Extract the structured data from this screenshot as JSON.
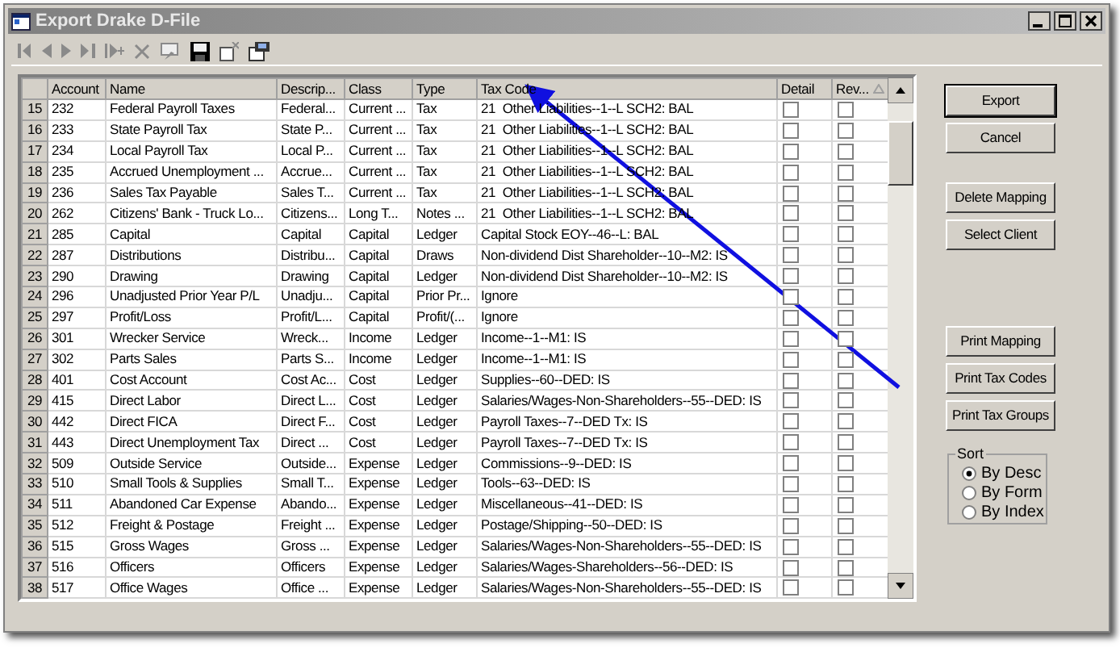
{
  "window": {
    "title": "Export Drake D-File"
  },
  "table": {
    "columns": [
      "Account",
      "Name",
      "Descrip...",
      "Class",
      "Type",
      "Tax Code",
      "Detail",
      "Rev..."
    ],
    "rows": [
      {
        "index": "15",
        "account": "232",
        "name": "Federal Payroll Taxes",
        "descrip": "Federal...",
        "class": "Current ...",
        "type": "Tax",
        "tax_code": "21  Other Liabilities--1--L SCH2: BAL",
        "detail": false,
        "rev": false
      },
      {
        "index": "16",
        "account": "233",
        "name": "State Payroll Tax",
        "descrip": "State P...",
        "class": "Current ...",
        "type": "Tax",
        "tax_code": "21  Other Liabilities--1--L SCH2: BAL",
        "detail": false,
        "rev": false
      },
      {
        "index": "17",
        "account": "234",
        "name": "Local Payroll Tax",
        "descrip": "Local P...",
        "class": "Current ...",
        "type": "Tax",
        "tax_code": "21  Other Liabilities--1--L SCH2: BAL",
        "detail": false,
        "rev": false
      },
      {
        "index": "18",
        "account": "235",
        "name": "Accrued Unemployment ...",
        "descrip": "Accrue...",
        "class": "Current ...",
        "type": "Tax",
        "tax_code": "21  Other Liabilities--1--L SCH2: BAL",
        "detail": false,
        "rev": false
      },
      {
        "index": "19",
        "account": "236",
        "name": "Sales Tax Payable",
        "descrip": "Sales T...",
        "class": "Current ...",
        "type": "Tax",
        "tax_code": "21  Other Liabilities--1--L SCH2: BAL",
        "detail": false,
        "rev": false
      },
      {
        "index": "20",
        "account": "262",
        "name": "Citizens' Bank - Truck Lo...",
        "descrip": "Citizens...",
        "class": "Long T...",
        "type": "Notes ...",
        "tax_code": "21  Other Liabilities--1--L SCH2: BAL",
        "detail": false,
        "rev": false
      },
      {
        "index": "21",
        "account": "285",
        "name": "Capital",
        "descrip": "Capital",
        "class": "Capital",
        "type": "Ledger",
        "tax_code": "Capital Stock EOY--46--L: BAL",
        "detail": false,
        "rev": false
      },
      {
        "index": "22",
        "account": "287",
        "name": "Distributions",
        "descrip": "Distribu...",
        "class": "Capital",
        "type": "Draws",
        "tax_code": "Non-dividend Dist Shareholder--10--M2: IS",
        "detail": false,
        "rev": false
      },
      {
        "index": "23",
        "account": "290",
        "name": "Drawing",
        "descrip": "Drawing",
        "class": "Capital",
        "type": "Ledger",
        "tax_code": "Non-dividend Dist Shareholder--10--M2: IS",
        "detail": false,
        "rev": false
      },
      {
        "index": "24",
        "account": "296",
        "name": "Unadjusted Prior Year P/L",
        "descrip": "Unadju...",
        "class": "Capital",
        "type": "Prior Pr...",
        "tax_code": "Ignore",
        "detail": false,
        "rev": false
      },
      {
        "index": "25",
        "account": "297",
        "name": "Profit/Loss",
        "descrip": "Profit/L...",
        "class": "Capital",
        "type": "Profit/(...",
        "tax_code": "Ignore",
        "detail": false,
        "rev": false
      },
      {
        "index": "26",
        "account": "301",
        "name": "Wrecker Service",
        "descrip": "Wreck...",
        "class": "Income",
        "type": "Ledger",
        "tax_code": "Income--1--M1: IS",
        "detail": false,
        "rev": false
      },
      {
        "index": "27",
        "account": "302",
        "name": "Parts Sales",
        "descrip": "Parts S...",
        "class": "Income",
        "type": "Ledger",
        "tax_code": "Income--1--M1: IS",
        "detail": false,
        "rev": false
      },
      {
        "index": "28",
        "account": "401",
        "name": "Cost Account",
        "descrip": "Cost Ac...",
        "class": "Cost",
        "type": "Ledger",
        "tax_code": "Supplies--60--DED: IS",
        "detail": false,
        "rev": false
      },
      {
        "index": "29",
        "account": "415",
        "name": "Direct Labor",
        "descrip": "Direct L...",
        "class": "Cost",
        "type": "Ledger",
        "tax_code": "Salaries/Wages-Non-Shareholders--55--DED: IS",
        "detail": false,
        "rev": false
      },
      {
        "index": "30",
        "account": "442",
        "name": "Direct FICA",
        "descrip": "Direct F...",
        "class": "Cost",
        "type": "Ledger",
        "tax_code": "Payroll Taxes--7--DED Tx: IS",
        "detail": false,
        "rev": false
      },
      {
        "index": "31",
        "account": "443",
        "name": "Direct Unemployment Tax",
        "descrip": "Direct ...",
        "class": "Cost",
        "type": "Ledger",
        "tax_code": "Payroll Taxes--7--DED Tx: IS",
        "detail": false,
        "rev": false
      },
      {
        "index": "32",
        "account": "509",
        "name": "Outside Service",
        "descrip": "Outside...",
        "class": "Expense",
        "type": "Ledger",
        "tax_code": "Commissions--9--DED: IS",
        "detail": false,
        "rev": false
      },
      {
        "index": "33",
        "account": "510",
        "name": "Small Tools & Supplies",
        "descrip": "Small T...",
        "class": "Expense",
        "type": "Ledger",
        "tax_code": "Tools--63--DED: IS",
        "detail": false,
        "rev": false
      },
      {
        "index": "34",
        "account": "511",
        "name": "Abandoned Car Expense",
        "descrip": "Abando...",
        "class": "Expense",
        "type": "Ledger",
        "tax_code": "Miscellaneous--41--DED: IS",
        "detail": false,
        "rev": false
      },
      {
        "index": "35",
        "account": "512",
        "name": "Freight & Postage",
        "descrip": "Freight ...",
        "class": "Expense",
        "type": "Ledger",
        "tax_code": "Postage/Shipping--50--DED: IS",
        "detail": false,
        "rev": false
      },
      {
        "index": "36",
        "account": "515",
        "name": "Gross Wages",
        "descrip": "Gross ...",
        "class": "Expense",
        "type": "Ledger",
        "tax_code": "Salaries/Wages-Non-Shareholders--55--DED: IS",
        "detail": false,
        "rev": false
      },
      {
        "index": "37",
        "account": "516",
        "name": "Officers",
        "descrip": "Officers",
        "class": "Expense",
        "type": "Ledger",
        "tax_code": "Salaries/Wages-Shareholders--56--DED: IS",
        "detail": false,
        "rev": false
      },
      {
        "index": "38",
        "account": "517",
        "name": "Office Wages",
        "descrip": "Office ...",
        "class": "Expense",
        "type": "Ledger",
        "tax_code": "Salaries/Wages-Non-Shareholders--55--DED: IS",
        "detail": false,
        "rev": false
      }
    ]
  },
  "buttons": [
    {
      "label": "Export",
      "default": true
    },
    {
      "label": "Cancel",
      "default": false
    },
    {
      "label": "Delete Mapping",
      "default": false
    },
    {
      "label": "Select Client",
      "default": false
    },
    {
      "label": "Print Mapping",
      "default": false
    },
    {
      "label": "Print Tax Codes",
      "default": false
    },
    {
      "label": "Print Tax Groups",
      "default": false
    }
  ],
  "sort": {
    "title": "Sort",
    "options": [
      {
        "label": "By Desc",
        "selected": true
      },
      {
        "label": "By Form",
        "selected": false
      },
      {
        "label": "By Index",
        "selected": false
      }
    ]
  }
}
